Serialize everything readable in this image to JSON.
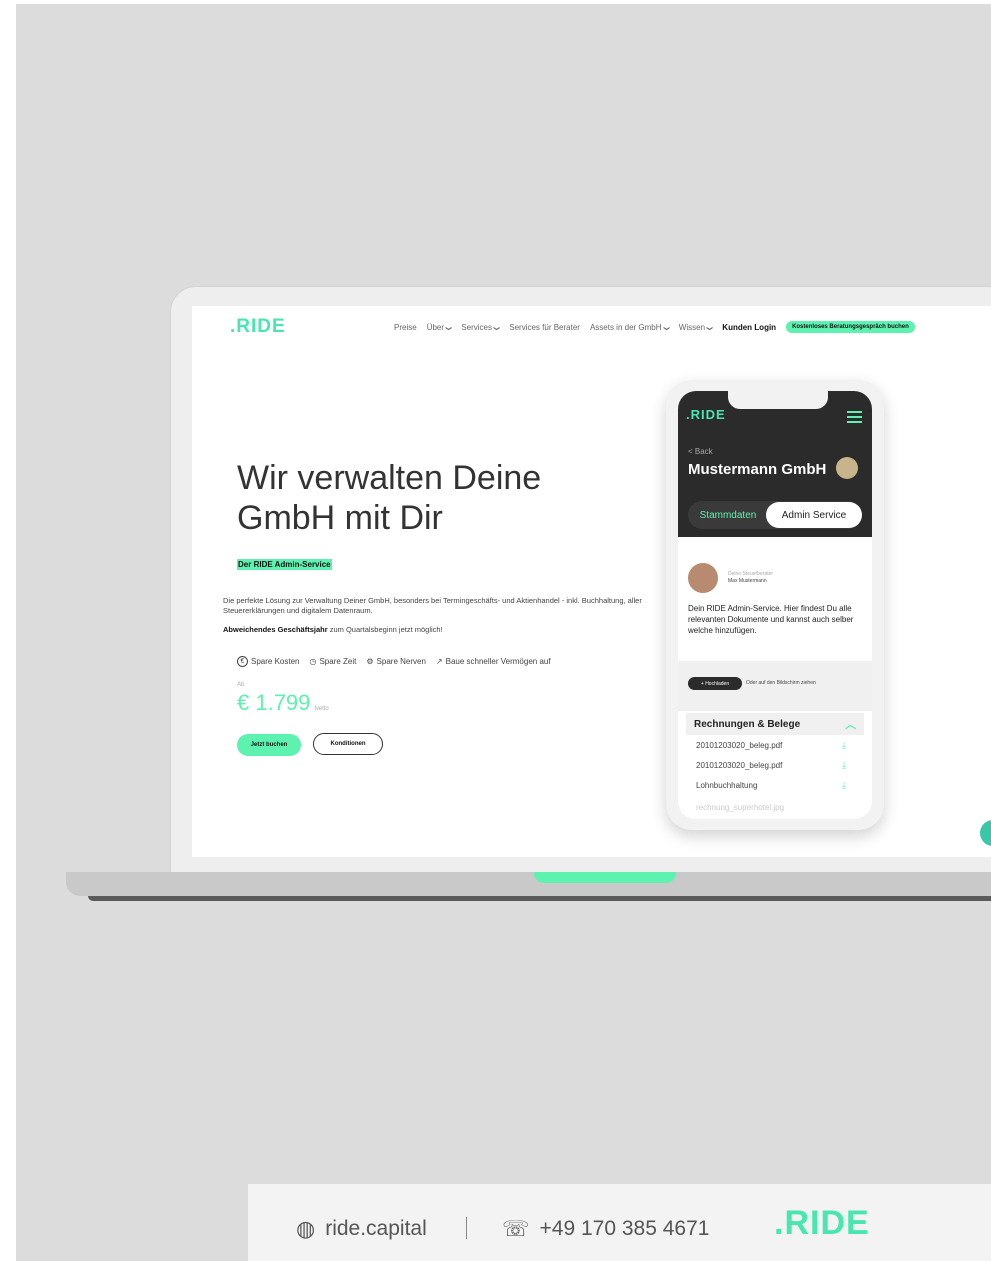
{
  "nav": {
    "logo": ".RIDE",
    "items": [
      "Preise",
      "Über",
      "Services",
      "Services für Berater",
      "Assets in der GmbH",
      "Wissen"
    ],
    "dropdown_indicator": "❯",
    "login": "Kunden Login",
    "cta": "Kostenloses Beratungsgespräch buchen"
  },
  "hero": {
    "title": "Wir verwalten Deine GmbH mit Dir",
    "highlight": "Der RIDE Admin-Service",
    "description": "Die perfekte Lösung zur Verwaltung Deiner GmbH, besonders bei Termingeschäfts- und Aktienhandel - inkl. Buchhaltung, aller Steuererklärungen und digitalem Datenraum.",
    "fiscal_bold": "Abweichendes Geschäftsjahr",
    "fiscal_rest": " zum Quartalsbeginn jetzt möglich!",
    "features": [
      {
        "icon": "euro-icon",
        "glyph": "€",
        "label": "Spare Kosten"
      },
      {
        "icon": "clock-icon",
        "glyph": "◷",
        "label": "Spare Zeit"
      },
      {
        "icon": "bike-icon",
        "glyph": "⚙",
        "label": "Spare Nerven"
      },
      {
        "icon": "trend-up-icon",
        "glyph": "↗",
        "label": "Baue schneller Vermögen auf"
      }
    ],
    "price_prefix": "Ab",
    "price": "€ 1.799",
    "price_suffix": "Netto",
    "book_label": "Jetzt buchen",
    "conditions_label": "Konditionen"
  },
  "phone": {
    "logo": ".RIDE",
    "back": "< Back",
    "company": "Mustermann GmbH",
    "tab_active": "Stammdaten",
    "tab_other": "Admin Service",
    "advisor_role": "Deine Steuerberater",
    "advisor_name": "Max Mustermann",
    "text": "Dein RIDE Admin-Service. Hier findest  Du alle relevanten Dokumente und kannst auch selber welche hinzufügen.",
    "upload_label": "+ Hochladen",
    "upload_hint": "Oder auf den Bildschirm ziehen",
    "section_title": "Rechnungen & Belege",
    "files": [
      "20101203020_beleg.pdf",
      "20101203020_beleg.pdf",
      "Lohnbuchhaltung",
      "rechnung_superhotel.jpg"
    ]
  },
  "footer": {
    "website": "ride.capital",
    "phone": "+49 170 385 4671",
    "logo": ".RIDE"
  },
  "colors": {
    "accent": "#5ef2b0",
    "logo": "#49e6b0",
    "dark": "#2b2b2b",
    "background": "#dcdcdc"
  }
}
